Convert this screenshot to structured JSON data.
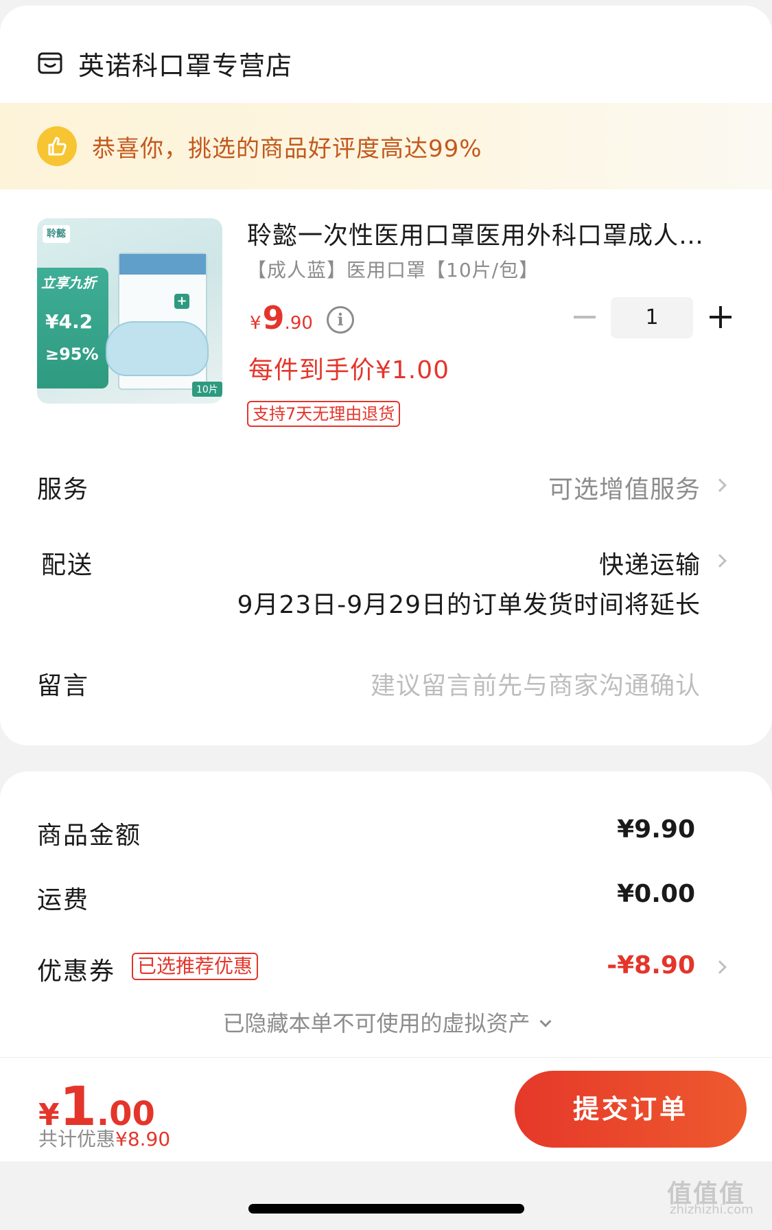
{
  "store": {
    "name": "英诺科口罩专营店",
    "icon": "store-icon"
  },
  "banner": {
    "text": "恭喜你，挑选的商品好评度高达99%",
    "icon": "thumbs-up-icon",
    "accent": "#f7c531"
  },
  "product": {
    "title": "聆懿一次性医用口罩医用外科口罩成人三层防护透气独立包装",
    "spec": "【成人蓝】医用口罩【10片/包】",
    "price_yen": "¥",
    "price_int": "9",
    "price_dec": ".90",
    "per_item_price": "每件到手价¥1.00",
    "return_tag": "支持7天无理由退货",
    "quantity": "1",
    "image_text": {
      "badge": "聆懿",
      "promo": "立享九折",
      "price": "¥4.2",
      "rate": "≥95%",
      "pack_count": "10片"
    }
  },
  "rows": {
    "service": {
      "label": "服务",
      "value": "可选增值服务"
    },
    "delivery": {
      "label": "配送",
      "value": "快递运输",
      "note": "9月23日-9月29日的订单发货时间将延长"
    },
    "message": {
      "label": "留言",
      "placeholder": "建议留言前先与商家沟通确认"
    }
  },
  "summary": {
    "goods_label": "商品金额",
    "goods_value": "¥9.90",
    "shipping_label": "运费",
    "shipping_value": "¥0.00",
    "coupon_label": "优惠券",
    "coupon_tag": "已选推荐优惠",
    "coupon_value": "-¥8.90",
    "hidden_assets": "已隐藏本单不可使用的虚拟资产"
  },
  "footer": {
    "total_yen": "¥",
    "total_int": "1",
    "total_dec": ".00",
    "discount_label": "共计优惠",
    "discount_value": "¥8.90",
    "submit_label": "提交订单"
  },
  "watermark": {
    "text": "值值值",
    "sub": "zhizhizhi.com"
  },
  "colors": {
    "accent_red": "#e4352b",
    "banner_text": "#c2591e"
  }
}
